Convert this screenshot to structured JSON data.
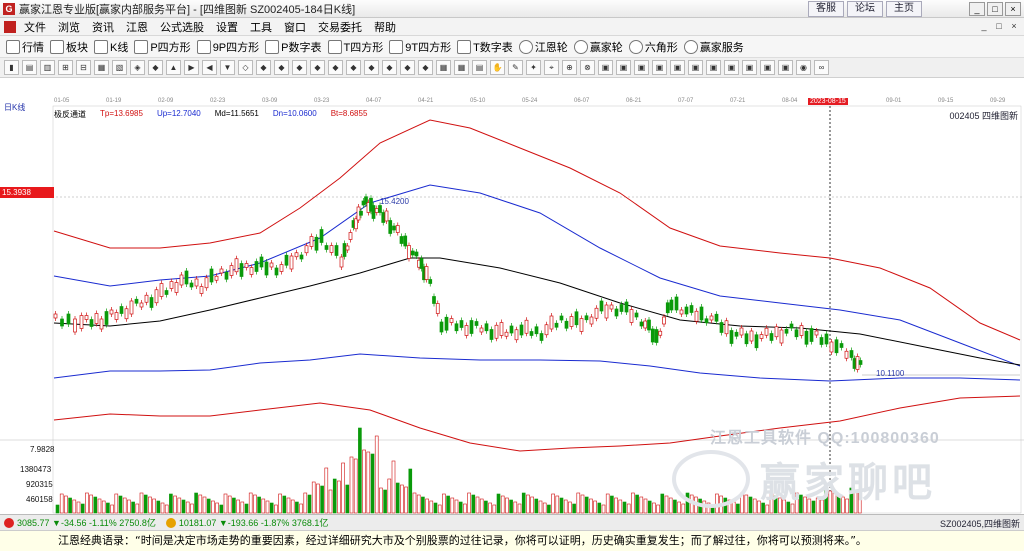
{
  "window": {
    "title": "赢家江恩专业版[赢家内部服务平台] - [四维图新   SZ002405-184日K线]",
    "links": [
      "客服",
      "论坛",
      "主页"
    ],
    "controls": [
      "_",
      "□",
      "×"
    ]
  },
  "menu": {
    "items": [
      "文件",
      "浏览",
      "资讯",
      "江恩",
      "公式选股",
      "设置",
      "工具",
      "窗口",
      "交易委托",
      "帮助"
    ],
    "window_controls": [
      "_",
      "□",
      "×"
    ]
  },
  "toolbar1": {
    "items": [
      {
        "label": "行情",
        "icon": "grid-icon"
      },
      {
        "label": "板块",
        "icon": "blocks-icon"
      },
      {
        "label": "K线",
        "icon": "kline-icon"
      },
      {
        "label": "P四方形",
        "icon": "p-square-icon"
      },
      {
        "label": "9P四方形",
        "icon": "9p-square-icon"
      },
      {
        "label": "P数字表",
        "icon": "p-table-icon"
      },
      {
        "label": "T四方形",
        "icon": "t-square-icon"
      },
      {
        "label": "9T四方形",
        "icon": "9t-square-icon"
      },
      {
        "label": "T数字表",
        "icon": "t-table-icon"
      },
      {
        "label": "江恩轮",
        "icon": "gann-wheel-icon"
      },
      {
        "label": "赢家轮",
        "icon": "winner-wheel-icon"
      },
      {
        "label": "六角形",
        "icon": "hexagon-icon"
      },
      {
        "label": "赢家服务",
        "icon": "dollar-icon"
      }
    ]
  },
  "toolbar2": {
    "count": 60
  },
  "chart": {
    "period_tag": "日K线",
    "stock_id": "002405  四维图新",
    "indicator_name": "极反通道",
    "legend": [
      {
        "label": "Tp=13.6985",
        "color": "#d01010"
      },
      {
        "label": "Up=12.7040",
        "color": "#1a2bd0"
      },
      {
        "label": "Md=11.5651",
        "color": "#000000"
      },
      {
        "label": "Dn=10.0600",
        "color": "#1a2bd0"
      },
      {
        "label": "Bt=8.6855",
        "color": "#d01010"
      }
    ],
    "current_price_label": "15.3938",
    "high_annotation": "15.4200",
    "low_annotation": "10.1100",
    "volume_label": "7.9828",
    "volume_ticks": [
      "1380473",
      "920315",
      "460158"
    ],
    "dates": [
      "01-05",
      "01-19",
      "02-09",
      "02-23",
      "03-09",
      "03-23",
      "04-07",
      "04-21",
      "05-10",
      "05-24",
      "06-07",
      "06-21",
      "07-07",
      "07-21",
      "08-04",
      "2023-08-15",
      "09-01",
      "09-15",
      "09-29"
    ],
    "highlight_date_index": 15,
    "colors": {
      "up": "#d01010",
      "down": "#0a9a0a",
      "tp": "#d01010",
      "up_band": "#1a2bd0",
      "md": "#000000"
    }
  },
  "watermark": {
    "line1": "江恩工具软件  QQ:100800360",
    "line2": "赢家聊吧"
  },
  "statusbar": {
    "sh_index": "3085.77 ▼-34.56 -1.11% 2750.8亿",
    "sz_index": "10181.07 ▼-193.66 -1.87% 3768.1亿",
    "right": "SZ002405,四维图新"
  },
  "quote": "江恩经典语录：“时间是决定市场走势的重要因素，经过详细研究大市及个别股票的过往记录，你将可以证明，历史确实重复发生；而了解过往，你将可以预测将来。”。"
}
